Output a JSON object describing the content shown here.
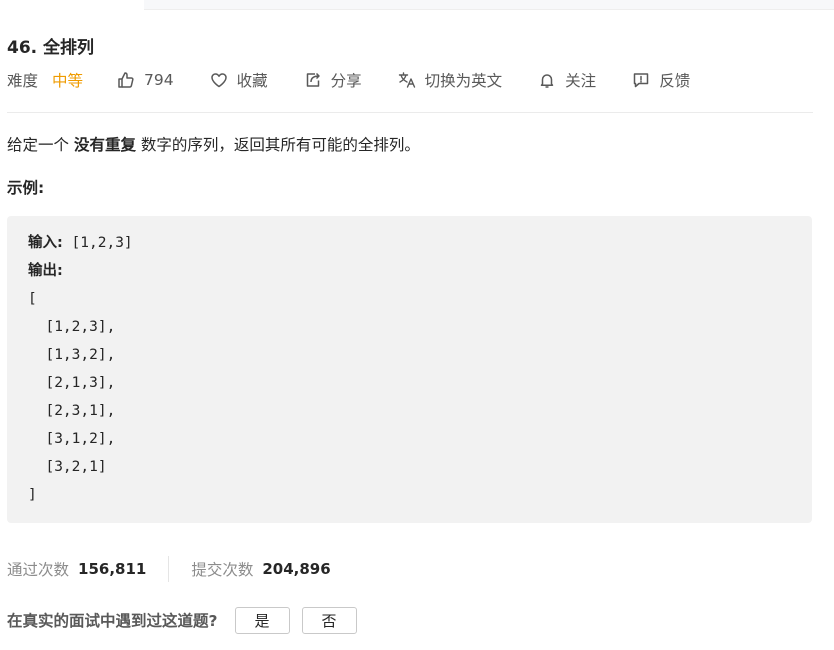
{
  "problem": {
    "title": "46. 全排列",
    "difficulty_label": "难度",
    "difficulty": "中等",
    "likes": "794",
    "favorite_label": "收藏",
    "share_label": "分享",
    "translate_label": "切换为英文",
    "follow_label": "关注",
    "feedback_label": "反馈"
  },
  "description": {
    "prefix": "给定一个 ",
    "bold": "没有重复",
    "suffix": " 数字的序列，返回其所有可能的全排列。"
  },
  "example": {
    "label": "示例:",
    "input_key": "输入:",
    "input_value": " [1,2,3]",
    "output_key": "输出:",
    "output_lines": [
      "[",
      "  [1,2,3],",
      "  [1,3,2],",
      "  [2,1,3],",
      "  [2,3,1],",
      "  [3,1,2],",
      "  [3,2,1]",
      "]"
    ]
  },
  "stats": {
    "accepted_label": "通过次数",
    "accepted_value": "156,811",
    "submitted_label": "提交次数",
    "submitted_value": "204,896"
  },
  "interview": {
    "question": "在真实的面试中遇到过这道题?",
    "yes_label": "是",
    "no_label": "否"
  },
  "colors": {
    "difficulty_medium": "#ef9b00",
    "code_background": "#f2f2f2"
  }
}
